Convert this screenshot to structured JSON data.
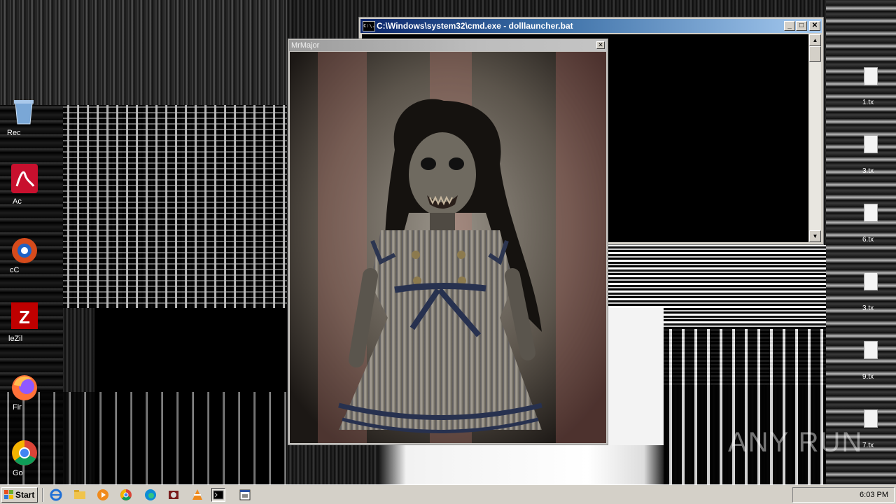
{
  "cmd_window": {
    "title": "C:\\Windows\\system32\\cmd.exe - dolllauncher.bat",
    "icon": "console-icon",
    "icon_text": "C:\\.",
    "minimize": "_",
    "maximize": "□",
    "close": "✕"
  },
  "popup_window": {
    "title": "MrMajor",
    "close": "✕",
    "image": "creepy-doll-picture"
  },
  "desktop": {
    "icons": [
      {
        "icon": "recycle-bin-icon",
        "label": "Rec"
      },
      {
        "icon": "acrobat-reader-icon",
        "label": "Ac"
      },
      {
        "icon": "ccleaner-icon",
        "label": "cC"
      },
      {
        "icon": "filezilla-icon",
        "label": "leZil"
      },
      {
        "icon": "firefox-icon",
        "label": "Fir"
      },
      {
        "icon": "chrome-icon",
        "label": "Go"
      }
    ],
    "files": [
      {
        "label": "1.tx"
      },
      {
        "label": "3.tx"
      },
      {
        "label": "6.tx"
      },
      {
        "label": "3.tx"
      },
      {
        "label": "9.tx"
      },
      {
        "label": "7.tx"
      }
    ]
  },
  "taskbar": {
    "start_label": "Start",
    "quick_launch": [
      "ie-icon",
      "explorer-icon",
      "media-player-icon",
      "chrome-icon",
      "edge-icon",
      "doll-app-icon",
      "vlc-icon",
      "cmd-icon",
      "window-icon"
    ],
    "clock": "6:03 PM"
  },
  "watermark": "ANY RUN"
}
